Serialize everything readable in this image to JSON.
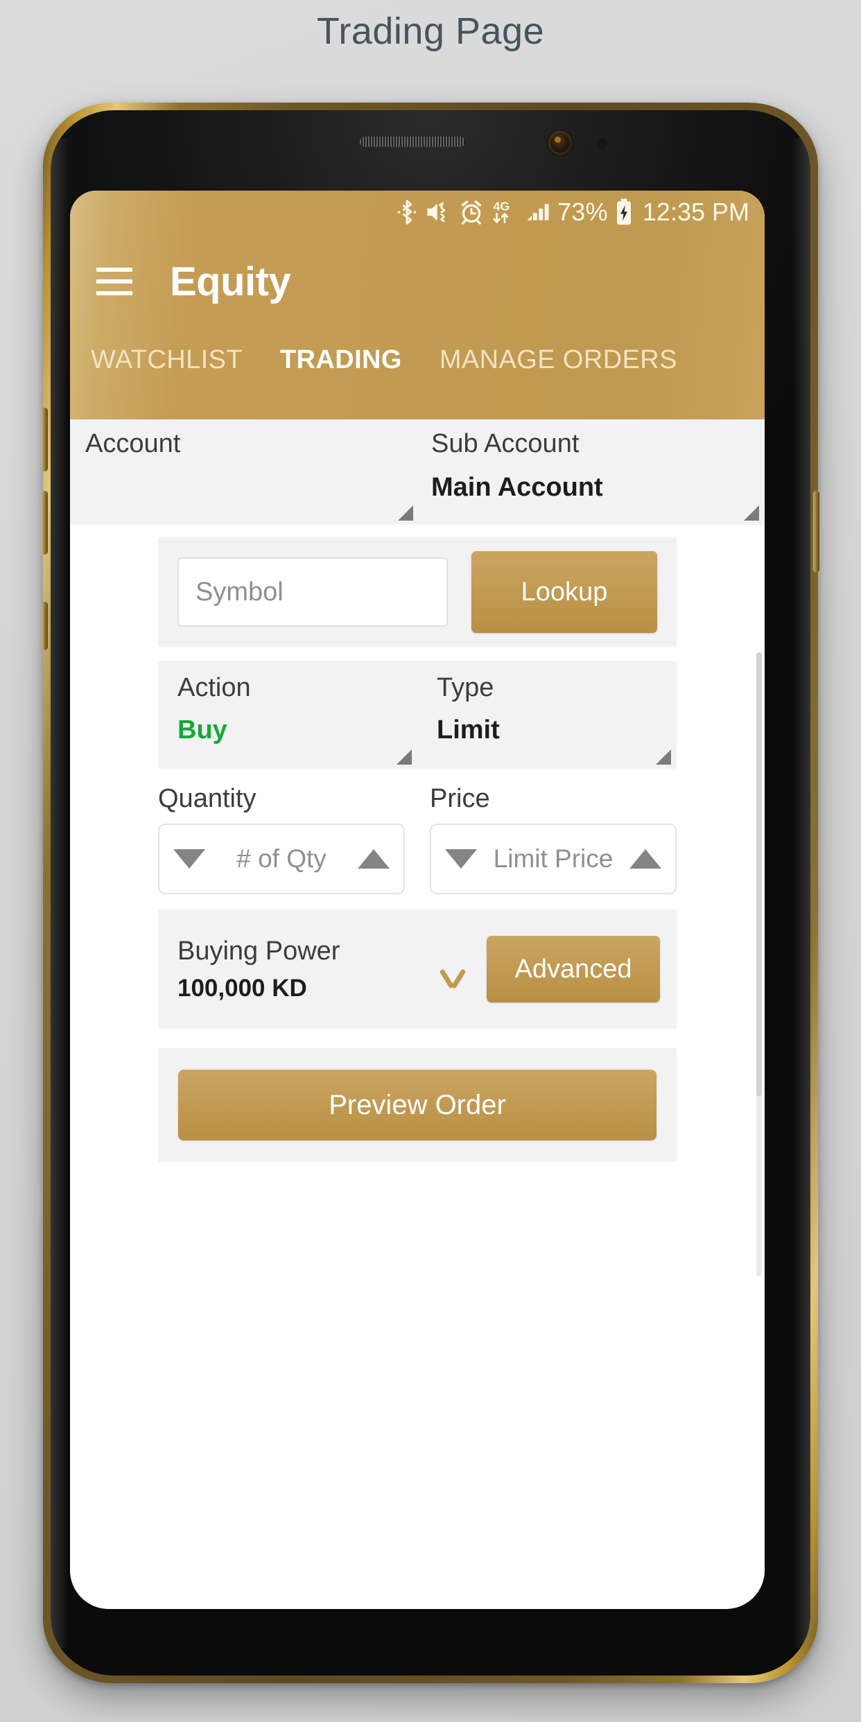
{
  "caption": {
    "title": "Trading Page"
  },
  "status_bar": {
    "icons": [
      "bluetooth-icon",
      "mute-vibrate-icon",
      "alarm-icon",
      "4g-data-icon",
      "signal-bars-icon"
    ],
    "network_label": "4G",
    "battery_percent": "73%",
    "battery_state": "charging",
    "time": "12:35 PM"
  },
  "app_bar": {
    "menu_icon": "hamburger-menu-icon",
    "title": "Equity"
  },
  "tabs": [
    {
      "label": "WATCHLIST",
      "active": false
    },
    {
      "label": "TRADING",
      "active": true
    },
    {
      "label": "MANAGE ORDERS",
      "active": false
    }
  ],
  "form": {
    "account": {
      "label": "Account",
      "value": ""
    },
    "sub_account": {
      "label": "Sub Account",
      "value": "Main Account"
    },
    "symbol": {
      "placeholder": "Symbol",
      "value": ""
    },
    "lookup_button": "Lookup",
    "action": {
      "label": "Action",
      "value": "Buy"
    },
    "type": {
      "label": "Type",
      "value": "Limit"
    },
    "quantity": {
      "label": "Quantity",
      "placeholder": "# of Qty",
      "value": ""
    },
    "price": {
      "label": "Price",
      "placeholder": "Limit Price",
      "value": ""
    },
    "buying_power": {
      "label": "Buying Power",
      "value": "100,000 KD"
    },
    "advanced_button": "Advanced",
    "preview_button": "Preview Order"
  },
  "colors": {
    "brand_gold": "#c29a51",
    "buy_green": "#16a836",
    "caption_text": "#47545c",
    "card_bg": "#f2f2f2"
  }
}
